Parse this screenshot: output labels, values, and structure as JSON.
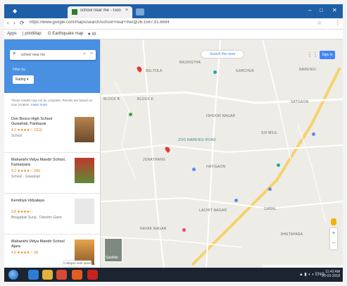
{
  "browser": {
    "tab_title": "school near me - Google M",
    "tab_close": "×",
    "url": "https://www.google.com/maps/search/school+near+me/@26.1587,91.6694",
    "new_tab": "+",
    "window_controls": {
      "minimize": "–",
      "maximize": "□",
      "close": "✕"
    },
    "nav": {
      "back": "‹",
      "forward": "›",
      "reload": "⟳"
    },
    "addr_right": {
      "star": "☆",
      "menu": "⋮"
    }
  },
  "bookmarks": [
    "Apps",
    "| printMap",
    "G Earthquake map",
    "★ M"
  ],
  "panel": {
    "search_query": "school near me",
    "filter_label": "Filter by",
    "filter_value": "Rating",
    "notice_text": "These results may not be complete. Results are based on your location.",
    "notice_link": "Learn more",
    "results": [
      {
        "title": "Don Bosco High School Guwahati, Panbazar",
        "rating": "4.1 ★★★★☆ (113)",
        "type": "School"
      },
      {
        "title": "Maharishi Vidya Mandir School, Kamarpara",
        "rating": "4.2 ★★★★☆ (46)",
        "type": "School · Guwahati"
      },
      {
        "title": "Kendriya Vidyalaya",
        "rating": "3.8 ★★★★☆",
        "type": "Bhagabati Suraj · Dakshin Gaon"
      },
      {
        "title": "Maharishi Vidya Mandir School Ajara",
        "rating": "4.0 ★★★★☆ (9)",
        "type": ""
      }
    ],
    "collapse_label": "Collapse side panel"
  },
  "map": {
    "search_area_button": "Search this area",
    "sign_in": "Sign in",
    "labels": [
      "BASHISTHA",
      "GARCHUK",
      "BELTOLA",
      "BLOCK E",
      "BLOCK B",
      "ISHOOR NAGAR",
      "SATGAON",
      "NARENGI",
      "SIX MILE",
      "ZOO NARENGI ROAD",
      "HATIGAON",
      "JUNATHANG",
      "GARAL",
      "LACHIT NAGAR",
      "NAYAK NAGAR",
      "BHETAPARA"
    ],
    "thumbnail_label": "Satellite",
    "zoom_in": "+",
    "zoom_out": "–"
  },
  "taskbar": {
    "tray_text": "▲ ▮ ◖ ◗ ENG",
    "time": "11:43 AM",
    "date": "20-03-2018"
  }
}
